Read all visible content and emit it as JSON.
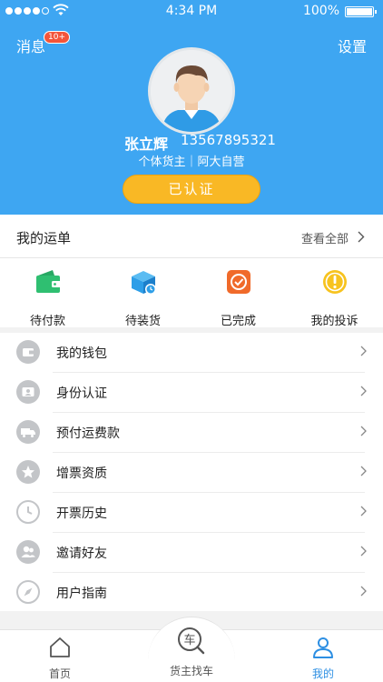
{
  "status_bar": {
    "time": "4:34 PM",
    "battery": "100%"
  },
  "header": {
    "messages_label": "消息",
    "messages_badge": "10+",
    "settings_label": "设置",
    "user_name": "张立辉",
    "phone": "13567895321",
    "user_type": "个体货主｜阿大自营",
    "verified_label": "已认证"
  },
  "orders": {
    "title": "我的运单",
    "view_all": "查看全部",
    "items": [
      {
        "label": "待付款",
        "icon": "wallet-icon",
        "color": "#2fbf71"
      },
      {
        "label": "待装货",
        "icon": "truck-box-icon",
        "color": "#2d9ee8"
      },
      {
        "label": "已完成",
        "icon": "check-icon",
        "color": "#f06a2a"
      },
      {
        "label": "我的投诉",
        "icon": "warning-icon",
        "color": "#f7c31e"
      }
    ]
  },
  "menu": {
    "items": [
      {
        "label": "我的钱包",
        "icon": "wallet-icon"
      },
      {
        "label": "身份认证",
        "icon": "id-card-icon"
      },
      {
        "label": "预付运费款",
        "icon": "truck-icon"
      },
      {
        "label": "增票资质",
        "icon": "star-badge-icon"
      },
      {
        "label": "开票历史",
        "icon": "clock-icon"
      },
      {
        "label": "邀请好友",
        "icon": "friends-icon"
      },
      {
        "label": "用户指南",
        "icon": "compass-icon"
      }
    ]
  },
  "tabbar": {
    "home": "首页",
    "find_truck": "货主找车",
    "mine": "我的",
    "find_truck_icon_text": "车"
  },
  "colors": {
    "primary": "#3ea6f2",
    "accent": "#f9b825",
    "badge": "#f3553a"
  }
}
